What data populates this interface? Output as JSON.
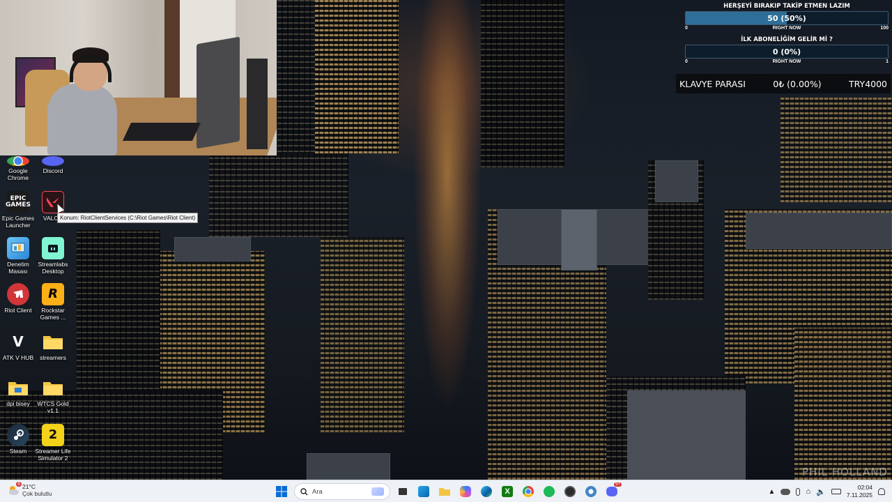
{
  "goals": [
    {
      "title": "HERŞEYİ BIRAKIP TAKİP ETMEN LAZIM",
      "value_text": "50 (50%)",
      "progress": 0.5,
      "min": "0",
      "label": "RIGHT NOW",
      "max": "100"
    },
    {
      "title": "İLK ABONELİĞİM GELİR Mİ ?",
      "value_text": "0 (0%)",
      "progress": 0.0,
      "min": "0",
      "label": "RIGHT NOW",
      "max": "1"
    }
  ],
  "donation": {
    "label": "KLAVYE PARASI",
    "value": "0₺ (0.00%)",
    "target": "TRY4000"
  },
  "desktop_icons": [
    {
      "label": "Google Chrome",
      "icon": "chrome-icon"
    },
    {
      "label": "Discord",
      "icon": "discord-icon"
    },
    {
      "label": "Epic Games Launcher",
      "icon": "epic-games-icon",
      "glyph": "EPIC\nGAMES"
    },
    {
      "label": "VALORANT",
      "icon": "valorant-icon"
    },
    {
      "label": "Denetim Masası",
      "icon": "control-panel-icon"
    },
    {
      "label": "Streamlabs Desktop",
      "icon": "streamlabs-icon"
    },
    {
      "label": "Riot Client",
      "icon": "riot-client-icon"
    },
    {
      "label": "Rockstar Games ...",
      "icon": "rockstar-icon",
      "glyph": "R"
    },
    {
      "label": "ATK V HUB",
      "icon": "atk-hub-icon",
      "glyph": "V"
    },
    {
      "label": "streamers",
      "icon": "folder-icon"
    },
    {
      "label": "dpi bisey",
      "icon": "folder-icon"
    },
    {
      "label": "WTCS Gold v1.1",
      "icon": "folder-icon"
    },
    {
      "label": "Steam",
      "icon": "steam-icon"
    },
    {
      "label": "Streamer Life Simulator 2",
      "icon": "streamer-life-icon",
      "glyph": "2"
    }
  ],
  "tooltip": "Konum: RiotClientServices (C:\\Riot Games\\Riot Client)",
  "valorant_short": "VALOR",
  "watermark": "PHIL HOLLAND",
  "taskbar": {
    "weather_temp": "21°C",
    "weather_desc": "Çok bulutlu",
    "weather_badge": "6",
    "search_placeholder": "Ara",
    "chrome_badge": "",
    "discord_badge": "9+",
    "time": "02:04",
    "date": "7.11.2025"
  },
  "colors": {
    "goal_fill": "#2e6f99",
    "taskbar_bg": "#eef1f6",
    "folder": "#f4c542"
  }
}
